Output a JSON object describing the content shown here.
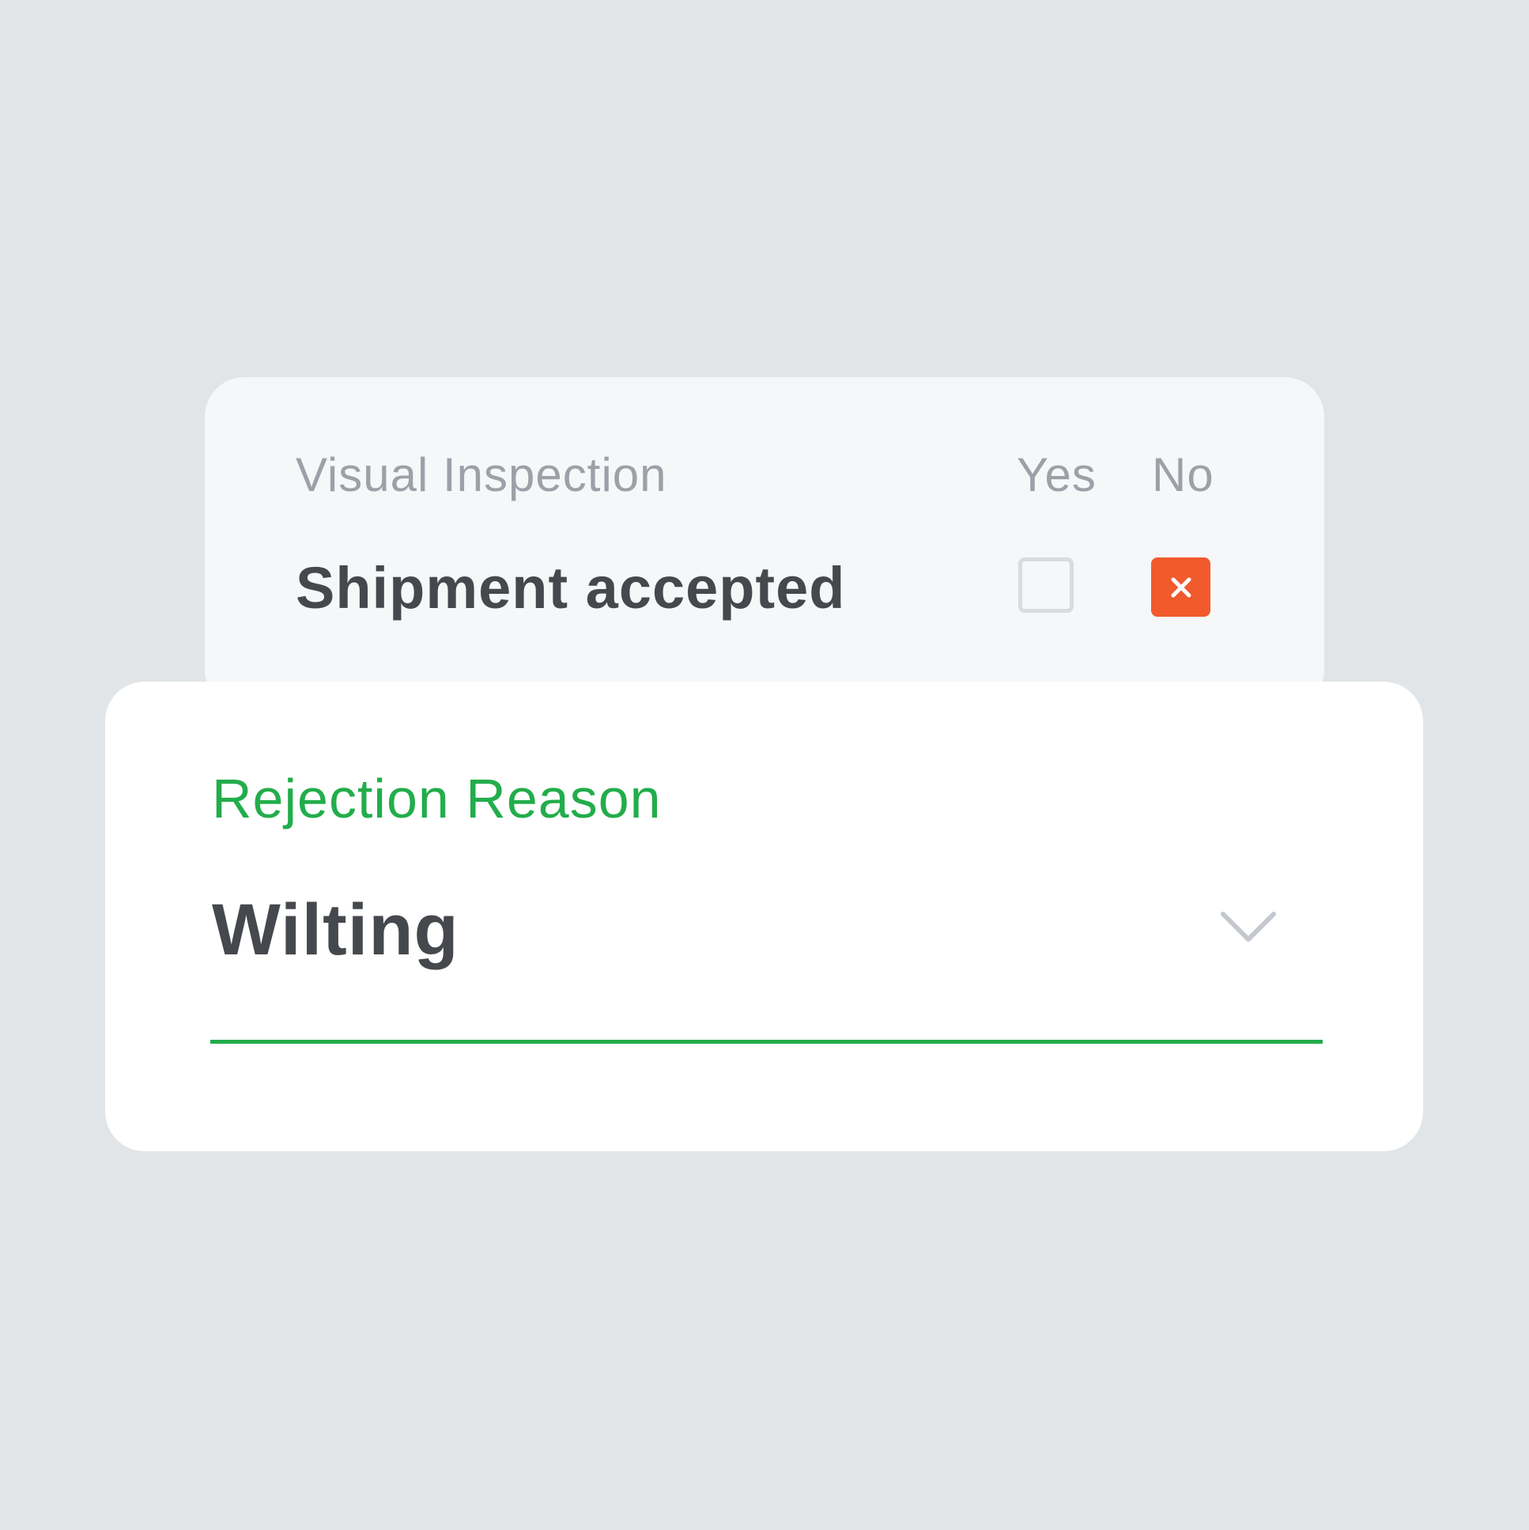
{
  "colors": {
    "background": "#e1e5e8",
    "accent_green": "#22ad4b",
    "reject_orange": "#f05a2c",
    "muted_text": "#9ca1a8",
    "primary_text": "#45484d"
  },
  "inspection": {
    "section_label": "Visual Inspection",
    "columns": {
      "yes_label": "Yes",
      "no_label": "No"
    },
    "item": {
      "label": "Shipment accepted",
      "yes_checked": false,
      "no_checked": true
    }
  },
  "rejection": {
    "label": "Rejection Reason",
    "selected_value": "Wilting",
    "dropdown_icon": "chevron-down-icon"
  },
  "icons": {
    "no_checkbox_mark": "close-icon"
  }
}
